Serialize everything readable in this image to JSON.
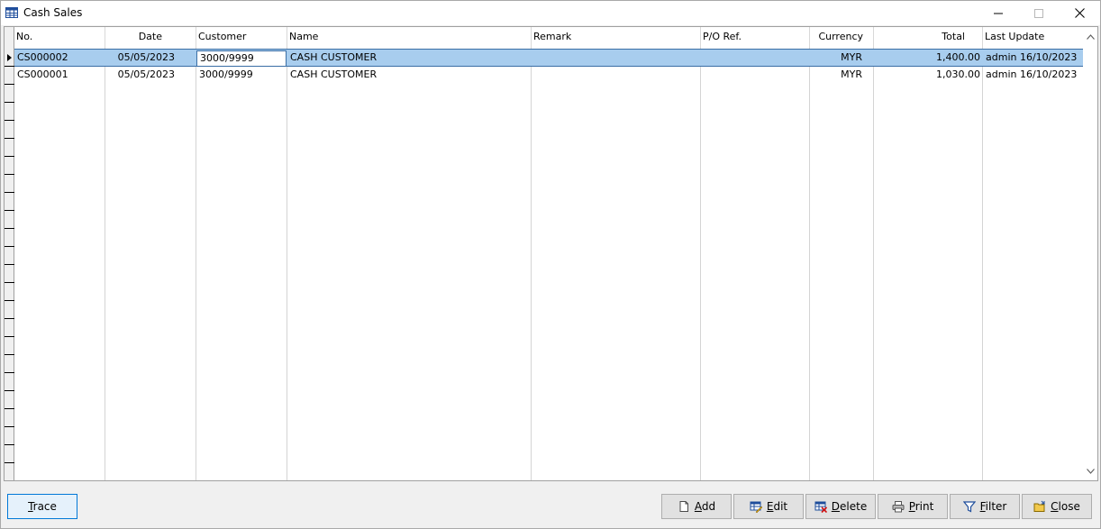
{
  "window": {
    "title": "Cash Sales"
  },
  "grid": {
    "columns": [
      "No.",
      "Date",
      "Customer",
      "Name",
      "Remark",
      "P/O Ref.",
      "Currency",
      "Total",
      "Last Update"
    ],
    "rows": [
      {
        "no": "CS000002",
        "date": "05/05/2023",
        "customer": "3000/9999",
        "name": "CASH CUSTOMER",
        "remark": "",
        "po_ref": "",
        "currency": "MYR",
        "total": "1,400.00",
        "last_update": "admin 16/10/2023"
      },
      {
        "no": "CS000001",
        "date": "05/05/2023",
        "customer": "3000/9999",
        "name": "CASH CUSTOMER",
        "remark": "",
        "po_ref": "",
        "currency": "MYR",
        "total": "1,030.00",
        "last_update": "admin 16/10/2023"
      }
    ]
  },
  "buttons": {
    "trace": {
      "first": "T",
      "rest": "race"
    },
    "add": {
      "first": "A",
      "rest": "dd"
    },
    "edit": {
      "first": "E",
      "rest": "dit"
    },
    "delete": {
      "first": "D",
      "rest": "elete"
    },
    "print": {
      "first": "P",
      "rest": "rint"
    },
    "filter": {
      "first": "F",
      "rest": "ilter"
    },
    "close": {
      "first": "C",
      "rest": "lose"
    }
  },
  "colors": {
    "selection": "#a8cdee",
    "accent": "#0078d7"
  }
}
